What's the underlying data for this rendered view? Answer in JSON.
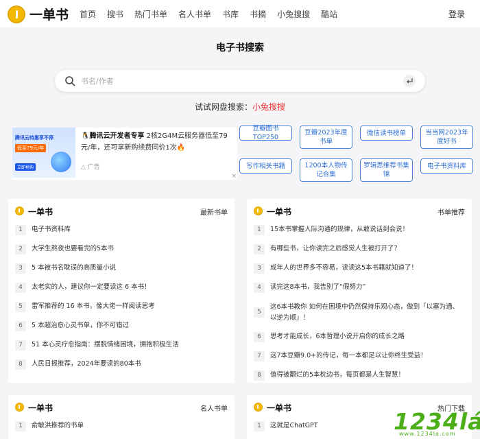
{
  "header": {
    "logo_text": "一单书",
    "nav": [
      "首页",
      "搜书",
      "热门书单",
      "名人书单",
      "书库",
      "书摘",
      "小兔搜搜",
      "酷站"
    ],
    "login": "登录"
  },
  "page_title": "电子书搜索",
  "search": {
    "placeholder": "书名/作者",
    "value": ""
  },
  "try_row": {
    "prefix": "试试网盘搜索：",
    "link": "小兔搜搜"
  },
  "ad": {
    "image_title": "腾讯云特惠享不停",
    "image_price": "低至79元/年",
    "image_button": "立即抢购",
    "text_title": "腾讯云开发者专享",
    "text_body": " 2核2G4M云服务器低至79元/年，还可享新购续费同价1次",
    "label": "广告",
    "close": "×"
  },
  "tags": [
    "豆瓣图书TOP250",
    "豆瓣2023年度书单",
    "微信读书榜单",
    "当当网2023年度好书",
    "写作相关书籍",
    "1200本人物传记合集",
    "罗辑思维荐书集锦",
    "电子书资料库"
  ],
  "cards": [
    {
      "title": "一单书",
      "more": "最新书单",
      "items": [
        {
          "n": "1",
          "text": "电子书资料库"
        },
        {
          "n": "2",
          "text": "大学生熬夜也要看完的5本书"
        },
        {
          "n": "3",
          "text": "5 本被书名耽误的高质量小说"
        },
        {
          "n": "4",
          "text": "太老实的人，建议你一定要读这 6 本书！"
        },
        {
          "n": "5",
          "text": "雷军推荐的 16 本书，像大佬一样阅读思考"
        },
        {
          "n": "6",
          "text": "5 本超治愈心灵书单，你不可错过"
        },
        {
          "n": "7",
          "text": "51 本心灵疗愈指南：摆脱情绪困境，拥抱积极生活"
        },
        {
          "n": "8",
          "text": "人民日报推荐，2024年要读的80本书"
        }
      ]
    },
    {
      "title": "一单书",
      "more": "书单推荐",
      "items": [
        {
          "n": "1",
          "text": "15本书掌握人际沟通的规律，从敢说话到会说！"
        },
        {
          "n": "2",
          "text": "有哪些书，让你读完之后感觉人生被打开了？"
        },
        {
          "n": "3",
          "text": "成年人的世界多不容易，读读这5本书籍就知道了！"
        },
        {
          "n": "4",
          "text": "读完这8本书，我告别了“假努力”"
        },
        {
          "n": "5",
          "text": "这6本书教你 如何在困境中仍然保持乐观心态，做到「以塞为通、以逆为顺」！"
        },
        {
          "n": "6",
          "text": "思考才能成长，6本哲理小说开启你的成长之路"
        },
        {
          "n": "7",
          "text": "这7本豆瓣9.0+的传记，每一本都足以让你终生受益！"
        },
        {
          "n": "8",
          "text": "值得被翻烂的5本枕边书，每页都是人生智慧！"
        }
      ]
    },
    {
      "title": "一单书",
      "more": "名人书单",
      "items": [
        {
          "n": "1",
          "text": "俞敏洪推荐的书单"
        }
      ]
    },
    {
      "title": "一单书",
      "more": "热门下载",
      "items": [
        {
          "n": "1",
          "text": "这就是ChatGPT"
        }
      ]
    }
  ],
  "watermark": {
    "main": "1234lá",
    "sub": "www.1234la.com"
  },
  "colors": {
    "accent_yellow": "#f5b800",
    "link_red": "#e33333",
    "tag_blue": "#2f6fd6",
    "watermark_green": "#4caf1a"
  }
}
